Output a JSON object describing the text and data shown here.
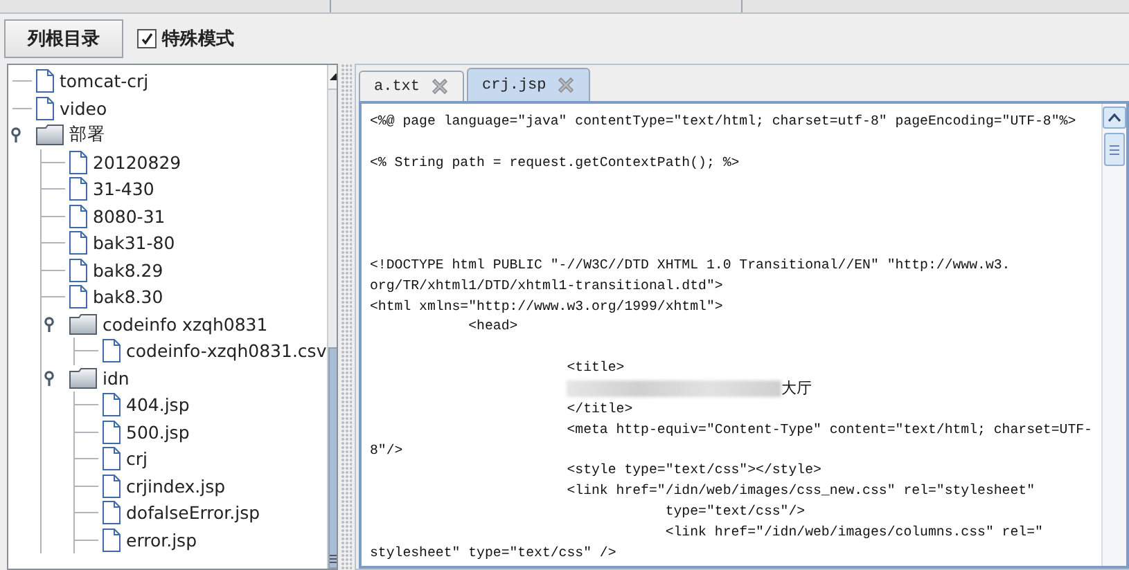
{
  "toolbar": {
    "root_button": "列根目录",
    "special_mode": {
      "label": "特殊模式",
      "checked": true
    }
  },
  "tree": [
    {
      "label": "tomcat-crj",
      "kind": "file"
    },
    {
      "label": "video",
      "kind": "file"
    },
    {
      "label": "部署",
      "kind": "folder",
      "expanded": true,
      "children": [
        {
          "label": "20120829",
          "kind": "file"
        },
        {
          "label": "31-430",
          "kind": "file"
        },
        {
          "label": "8080-31",
          "kind": "file"
        },
        {
          "label": "bak31-80",
          "kind": "file"
        },
        {
          "label": "bak8.29",
          "kind": "file"
        },
        {
          "label": "bak8.30",
          "kind": "file"
        },
        {
          "label": "codeinfo xzqh0831",
          "kind": "folder",
          "expanded": true,
          "children": [
            {
              "label": "codeinfo-xzqh0831.csv",
              "kind": "file"
            }
          ]
        },
        {
          "label": "idn",
          "kind": "folder",
          "expanded": true,
          "children": [
            {
              "label": "404.jsp",
              "kind": "file"
            },
            {
              "label": "500.jsp",
              "kind": "file"
            },
            {
              "label": "crj",
              "kind": "file"
            },
            {
              "label": "crjindex.jsp",
              "kind": "file"
            },
            {
              "label": "dofalseError.jsp",
              "kind": "file"
            },
            {
              "label": "error.jsp",
              "kind": "file"
            }
          ]
        }
      ]
    }
  ],
  "editor": {
    "tabs": [
      {
        "label": "a.txt",
        "selected": false
      },
      {
        "label": "crj.jsp",
        "selected": true
      }
    ],
    "lines": [
      {
        "kind": "code",
        "text": "<%@ page language=\"java\" contentType=\"text/html; charset=utf-8\" pageEncoding=\"UTF-8\"%>"
      },
      {
        "kind": "blank"
      },
      {
        "kind": "code",
        "text": "<% String path = request.getContextPath(); %>"
      },
      {
        "kind": "blank"
      },
      {
        "kind": "blank"
      },
      {
        "kind": "blank"
      },
      {
        "kind": "blank"
      },
      {
        "kind": "code",
        "text": "<!DOCTYPE html PUBLIC \"-//W3C//DTD XHTML 1.0 Transitional//EN\" \"http://www.w3."
      },
      {
        "kind": "code",
        "text": "org/TR/xhtml1/DTD/xhtml1-transitional.dtd\">"
      },
      {
        "kind": "code",
        "text": "<html xmlns=\"http://www.w3.org/1999/xhtml\">"
      },
      {
        "kind": "code",
        "text": "            <head>"
      },
      {
        "kind": "blank"
      },
      {
        "kind": "code",
        "text": "                        <title>"
      },
      {
        "kind": "redacted",
        "text": "大厅"
      },
      {
        "kind": "code",
        "text": "                        </title>"
      },
      {
        "kind": "code",
        "text": "                        <meta http-equiv=\"Content-Type\" content=\"text/html; charset=UTF-"
      },
      {
        "kind": "code",
        "text": "8\"/>"
      },
      {
        "kind": "code",
        "text": "                        <style type=\"text/css\"></style>"
      },
      {
        "kind": "code",
        "text": "                        <link href=\"/idn/web/images/css_new.css\" rel=\"stylesheet\""
      },
      {
        "kind": "code",
        "text": "                                    type=\"text/css\"/>"
      },
      {
        "kind": "code",
        "text": "                                    <link href=\"/idn/web/images/columns.css\" rel=\""
      },
      {
        "kind": "code",
        "text": "stylesheet\" type=\"text/css\" />"
      }
    ]
  }
}
